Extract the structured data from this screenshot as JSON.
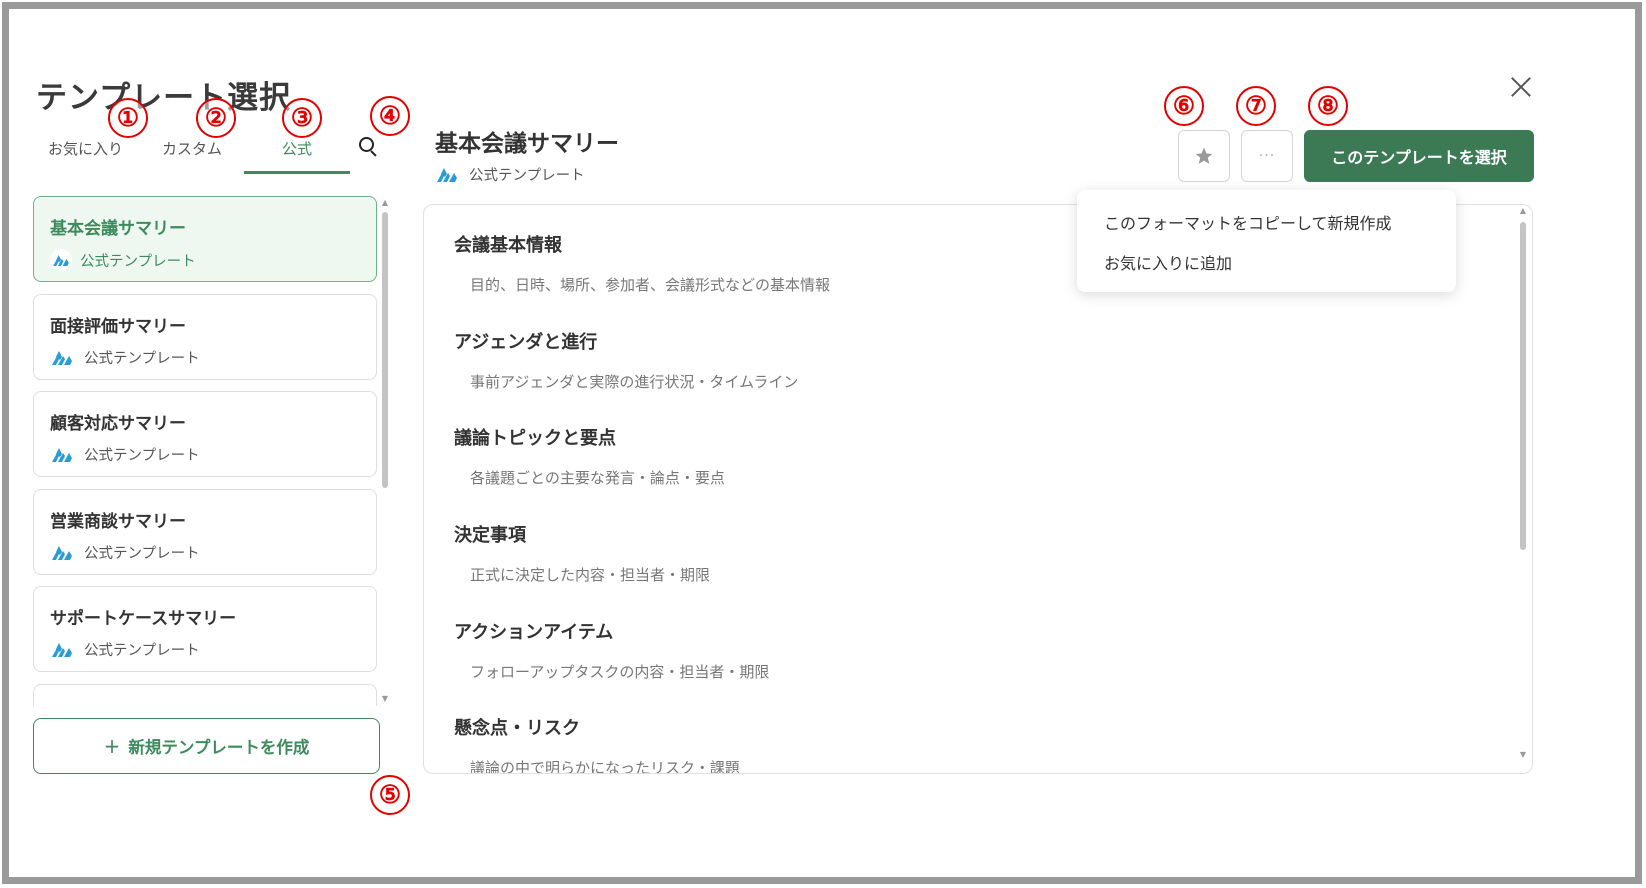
{
  "dialog": {
    "title": "テンプレート選択"
  },
  "tabs": [
    {
      "label": "お気に入り"
    },
    {
      "label": "カスタム"
    },
    {
      "label": "公式",
      "active": true
    }
  ],
  "search": {
    "icon": "search-icon"
  },
  "template_list": [
    {
      "title": "基本会議サマリー",
      "subtitle": "公式テンプレート",
      "selected": true
    },
    {
      "title": "面接評価サマリー",
      "subtitle": "公式テンプレート"
    },
    {
      "title": "顧客対応サマリー",
      "subtitle": "公式テンプレート"
    },
    {
      "title": "営業商談サマリー",
      "subtitle": "公式テンプレート"
    },
    {
      "title": "サポートケースサマリー",
      "subtitle": "公式テンプレート"
    }
  ],
  "new_template_button": {
    "icon": "plus-icon",
    "label": "新規テンプレートを作成"
  },
  "detail": {
    "title": "基本会議サマリー",
    "subtitle": "公式テンプレート",
    "sections": [
      {
        "title": "会議基本情報",
        "description": "目的、日時、場所、参加者、会議形式などの基本情報"
      },
      {
        "title": "アジェンダと進行",
        "description": "事前アジェンダと実際の進行状況・タイムライン"
      },
      {
        "title": "議論トピックと要点",
        "description": "各議題ごとの主要な発言・論点・要点"
      },
      {
        "title": "決定事項",
        "description": "正式に決定した内容・担当者・期限"
      },
      {
        "title": "アクションアイテム",
        "description": "フォローアップタスクの内容・担当者・期限"
      },
      {
        "title": "懸念点・リスク",
        "description": "議論の中で明らかになったリスク・課題"
      }
    ]
  },
  "header_actions": {
    "favorite_icon": "star-icon",
    "more_label": "···",
    "select_label": "このテンプレートを選択",
    "close_icon": "close-icon"
  },
  "more_menu": [
    {
      "label": "このフォーマットをコピーして新規作成"
    },
    {
      "label": "お気に入りに追加"
    }
  ],
  "annotations": [
    "①",
    "②",
    "③",
    "④",
    "⑤",
    "⑥",
    "⑦",
    "⑧"
  ],
  "colors": {
    "accent": "#3d8a5c",
    "primary_button": "#3b7a55",
    "selected_card_bg": "#eef7f0",
    "marker": "#e30000",
    "logo": "#2a9bd6"
  }
}
